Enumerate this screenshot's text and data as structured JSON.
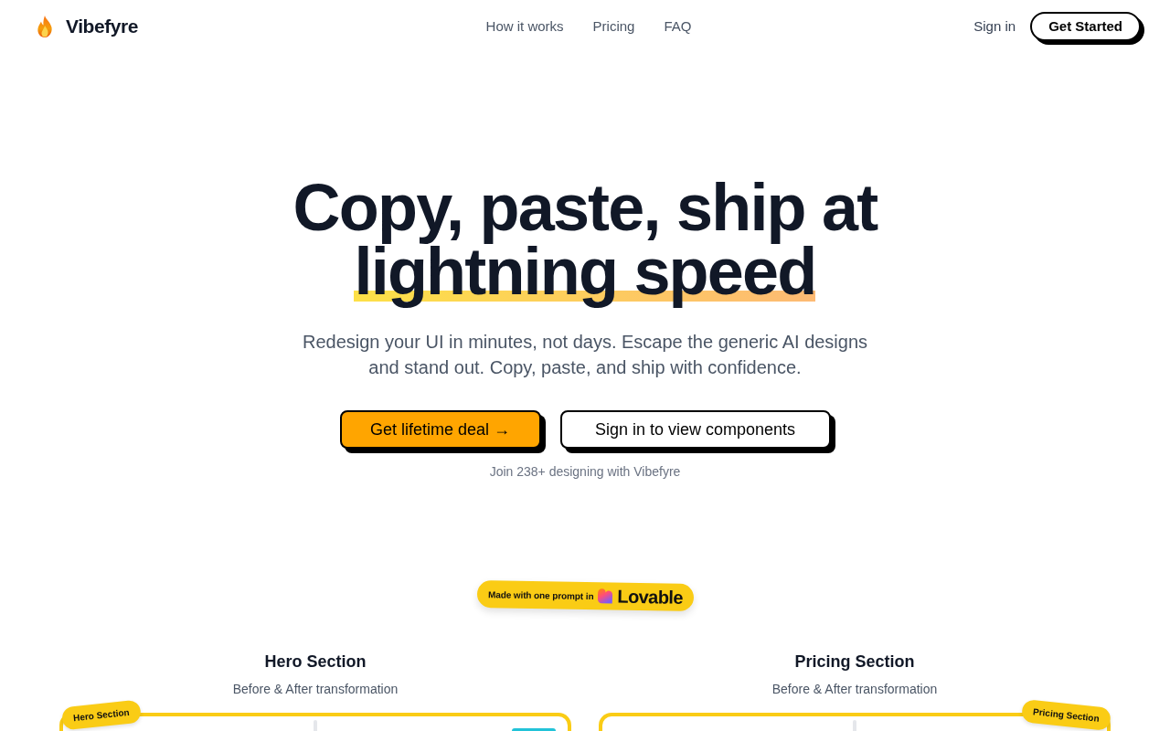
{
  "header": {
    "logo": "Vibefyre",
    "nav_links": [
      "How it works",
      "Pricing",
      "FAQ"
    ],
    "sign_in": "Sign in",
    "cta": "Get Started"
  },
  "hero": {
    "headline": "Copy, paste, ship at",
    "headline_highlight": "lightning speed",
    "subtitle": "Redesign your UI in minutes, not days. Escape the generic AI designs and stand out. Copy, paste, and ship with confidence.",
    "buttons": [
      {
        "label": "Get lifetime deal →",
        "kind": "primary"
      },
      {
        "label": "Sign in to view components",
        "kind": "secondary"
      }
    ],
    "social_proof": "Join 238+ designing with Vibefyre"
  },
  "badge": {
    "prefix": "Made with one prompt in",
    "brand": "Lovable"
  },
  "showcases": [
    {
      "kind": "hero",
      "title": "Hero Section",
      "subtitle": "Before & After transformation",
      "tag": "Hero Section"
    },
    {
      "kind": "pricing",
      "title": "Pricing Section",
      "subtitle": "Before & After transformation",
      "tag": "Pricing Section"
    }
  ]
}
